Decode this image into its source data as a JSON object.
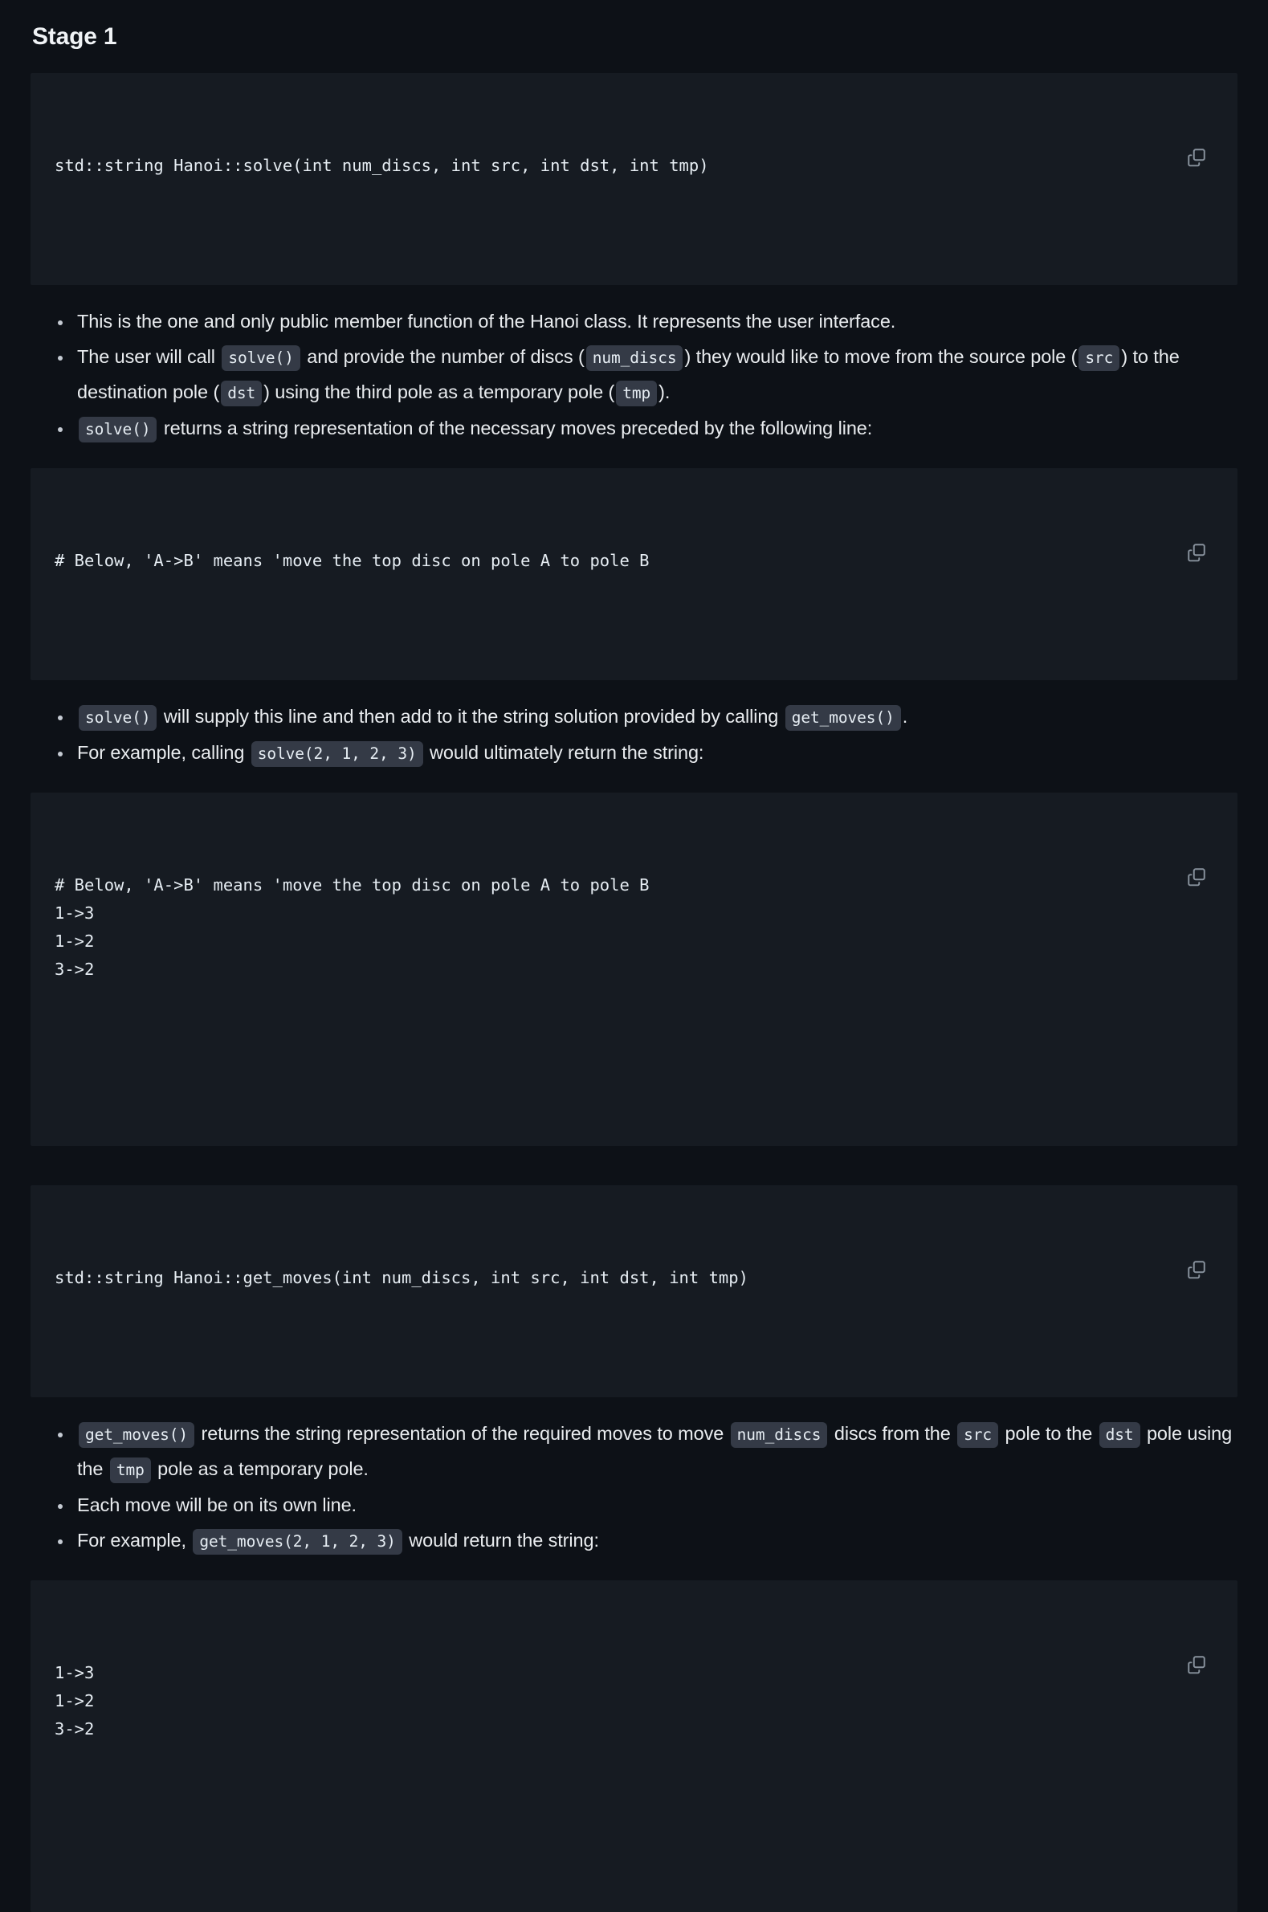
{
  "heading": "Stage 1",
  "icons": {
    "copy": "copy-icon"
  },
  "colors": {
    "page_background": "#0d1117",
    "codeblock_background": "#161b22",
    "inline_code_background": "#343a46",
    "text": "#e9ecef"
  },
  "blocks": {
    "solve_signature": {
      "lines": [
        "std::string Hanoi::solve(int num_discs, int src, int dst, int tmp)"
      ]
    },
    "solve_header_line": {
      "lines": [
        "# Below, 'A->B' means 'move the top disc on pole A to pole B"
      ]
    },
    "solve_example_output": {
      "lines": [
        "# Below, 'A->B' means 'move the top disc on pole A to pole B",
        "1->3",
        "1->2",
        "3->2"
      ]
    },
    "get_moves_signature": {
      "lines": [
        "std::string Hanoi::get_moves(int num_discs, int src, int dst, int tmp)"
      ]
    },
    "get_moves_example_output": {
      "lines": [
        "1->3",
        "1->2",
        "3->2"
      ]
    }
  },
  "bullets_group_1": [
    {
      "parts": [
        {
          "type": "text",
          "value": "This is the one and only public member function of the Hanoi class. It represents the user interface."
        }
      ]
    },
    {
      "parts": [
        {
          "type": "text",
          "value": "The user will call "
        },
        {
          "type": "code",
          "value": "solve()"
        },
        {
          "type": "text",
          "value": " and provide the number of discs ("
        },
        {
          "type": "code",
          "value": "num_discs"
        },
        {
          "type": "text",
          "value": ") they would like to move from the source pole ("
        },
        {
          "type": "code",
          "value": "src"
        },
        {
          "type": "text",
          "value": ") to the destination pole ("
        },
        {
          "type": "code",
          "value": "dst"
        },
        {
          "type": "text",
          "value": ") using the third pole as a temporary pole ("
        },
        {
          "type": "code",
          "value": "tmp"
        },
        {
          "type": "text",
          "value": ")."
        }
      ]
    },
    {
      "parts": [
        {
          "type": "code",
          "value": "solve()"
        },
        {
          "type": "text",
          "value": " returns a string representation of the necessary moves preceded by the following line:"
        }
      ]
    }
  ],
  "bullets_group_2": [
    {
      "parts": [
        {
          "type": "code",
          "value": "solve()"
        },
        {
          "type": "text",
          "value": " will supply this line and then add to it the string solution provided by calling "
        },
        {
          "type": "code",
          "value": "get_moves()"
        },
        {
          "type": "text",
          "value": "."
        }
      ]
    },
    {
      "parts": [
        {
          "type": "text",
          "value": "For example, calling "
        },
        {
          "type": "code",
          "value": "solve(2, 1, 2, 3)"
        },
        {
          "type": "text",
          "value": " would ultimately return the string:"
        }
      ]
    }
  ],
  "bullets_group_3": [
    {
      "parts": [
        {
          "type": "code",
          "value": "get_moves()"
        },
        {
          "type": "text",
          "value": " returns the string representation of the required moves to move "
        },
        {
          "type": "code",
          "value": "num_discs"
        },
        {
          "type": "text",
          "value": " discs from the "
        },
        {
          "type": "code",
          "value": "src"
        },
        {
          "type": "text",
          "value": " pole to the "
        },
        {
          "type": "code",
          "value": "dst"
        },
        {
          "type": "text",
          "value": " pole using the "
        },
        {
          "type": "code",
          "value": "tmp"
        },
        {
          "type": "text",
          "value": " pole as a temporary pole."
        }
      ]
    },
    {
      "parts": [
        {
          "type": "text",
          "value": "Each move will be on its own line."
        }
      ]
    },
    {
      "parts": [
        {
          "type": "text",
          "value": "For example, "
        },
        {
          "type": "code",
          "value": "get_moves(2, 1, 2, 3)"
        },
        {
          "type": "text",
          "value": " would return the string:"
        }
      ]
    }
  ]
}
